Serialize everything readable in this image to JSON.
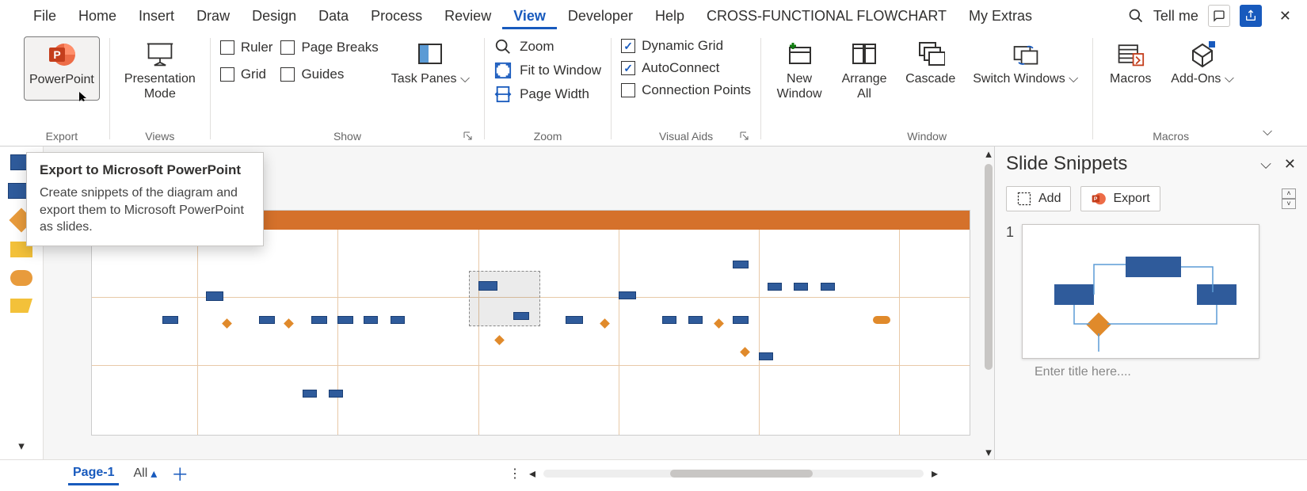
{
  "menu": {
    "items": [
      "File",
      "Home",
      "Insert",
      "Draw",
      "Design",
      "Data",
      "Process",
      "Review",
      "View",
      "Developer",
      "Help",
      "CROSS-FUNCTIONAL FLOWCHART",
      "My Extras"
    ],
    "active": "View",
    "tellme": "Tell me"
  },
  "ribbon": {
    "export": {
      "powerpoint": "PowerPoint",
      "label": "Export"
    },
    "views": {
      "presentation": "Presentation Mode",
      "label": "Views"
    },
    "show": {
      "ruler": "Ruler",
      "pagebreaks": "Page Breaks",
      "grid": "Grid",
      "guides": "Guides",
      "taskpanes": "Task Panes",
      "label": "Show"
    },
    "zoom": {
      "zoom": "Zoom",
      "fit": "Fit to Window",
      "pagewidth": "Page Width",
      "label": "Zoom"
    },
    "visual": {
      "dynamic": "Dynamic Grid",
      "auto": "AutoConnect",
      "conn": "Connection Points",
      "label": "Visual Aids"
    },
    "window": {
      "neww": "New Window",
      "arrange": "Arrange All",
      "cascade": "Cascade",
      "switch": "Switch Windows",
      "label": "Window"
    },
    "macros": {
      "macros": "Macros",
      "addons": "Add-Ons",
      "label": "Macros"
    }
  },
  "tooltip": {
    "title": "Export to Microsoft PowerPoint",
    "body": "Create snippets of the diagram and export them to Microsoft PowerPoint as slides."
  },
  "panel": {
    "title": "Slide Snippets",
    "add": "Add",
    "export": "Export",
    "slide1_num": "1",
    "placeholder": "Enter title here...."
  },
  "bottom": {
    "page": "Page-1",
    "all": "All"
  }
}
